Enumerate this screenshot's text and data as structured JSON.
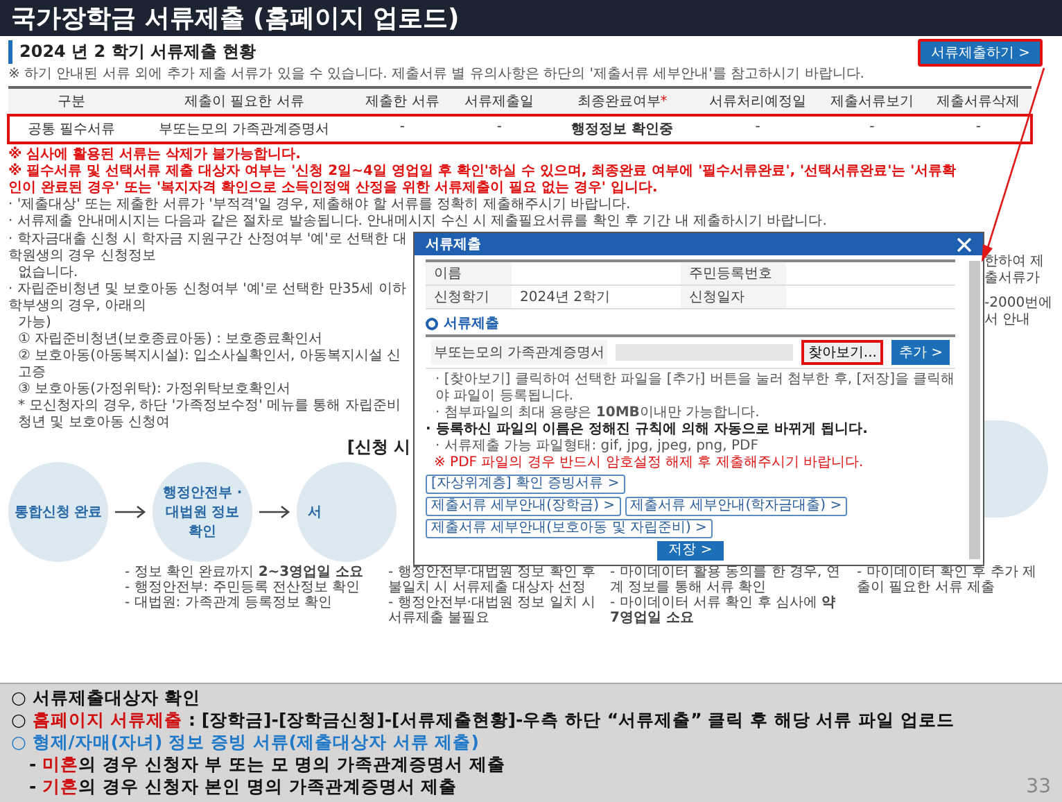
{
  "slide_title": "국가장학금 서류제출 (홈페이지 업로드)",
  "web": {
    "heading": "2024 년 2 학기 서류제출 현황",
    "submit_button": {
      "label": "서류제출하기 >",
      "highlighted": true
    },
    "notice": "※ 하기 안내된 서류 외에 추가 제출 서류가 있을 수 있습니다. 제출서류 별 유의사항은 하단의 '제출서류 세부안내'를 참고하시기 바랍니다.",
    "table": {
      "columns": [
        {
          "label": "구분"
        },
        {
          "label": "제출이 필요한 서류"
        },
        {
          "label": "제출한 서류"
        },
        {
          "label": "서류제출일"
        },
        {
          "label": "최종완료여부",
          "mark": "*"
        },
        {
          "label": "서류처리예정일"
        },
        {
          "label": "제출서류보기"
        },
        {
          "label": "제출서류삭제"
        }
      ],
      "rows": [
        {
          "highlighted": true,
          "cells": [
            {
              "text": "공통 필수서류",
              "bold": false
            },
            {
              "text": "부또는모의 가족관계증명서",
              "bold": false
            },
            {
              "text": "-",
              "bold": false
            },
            {
              "text": "-",
              "bold": false
            },
            {
              "text": "행정정보 확인중",
              "bold": true
            },
            {
              "text": "-",
              "bold": false
            },
            {
              "text": "-",
              "bold": false
            },
            {
              "text": "-",
              "bold": false
            }
          ]
        }
      ]
    },
    "warnings": [
      "※ 심사에 활용된 서류는 삭제가 불가능합니다.",
      "※ 필수서류 및 선택서류 제출 대상자 여부는 '신청 2일~4일 영업일 후 확인'하실 수 있으며, 최종완료 여부에 '필수서류완료', '선택서류완료'는 '서류확인이 완료된 경우' 또는 '복지자격 확인으로 소득인정액 산정을 위한 서류제출이 필요 없는 경우' 입니다."
    ],
    "bullets": [
      "· '제출대상' 또는 제출한 서류가 '부적격'일 경우, 제출해야 할 서류를 정확히 제출해주시기 바랍니다.",
      "· 서류제출 안내메시지는 다음과 같은 절차로 발송됩니다. 안내메시지 수신 시 제출필요서류를 확인 후 기간 내 제출하시기 바랍니다."
    ],
    "left_notes": [
      {
        "kind": "bullet",
        "text": "· 학자금대출 신청 시 학자금 지원구간 산정여부 '예'로 선택한 대학원생의 경우 신청정보"
      },
      {
        "kind": "plain",
        "text": "없습니다."
      },
      {
        "kind": "bullet",
        "text": "· 자립준비청년 및 보호아동 신청여부 '예'로 선택한 만35세 이하 학부생의 경우, 아래의"
      },
      {
        "kind": "plain",
        "text": "가능)"
      },
      {
        "kind": "sub",
        "text": "① 자립준비청년(보호종료아동) : 보호종료확인서"
      },
      {
        "kind": "sub",
        "text": "② 보호아동(아동복지시설): 입소사실확인서, 아동복지시설 신고증"
      },
      {
        "kind": "sub",
        "text": "③ 보호아동(가정위탁): 가정위탁보호확인서"
      },
      {
        "kind": "sub",
        "text": "* 모신청자의 경우, 하단 '가족정보수정' 메뉴를 통해 자립준비청년 및 보호아동 신청여"
      }
    ],
    "right_notes": [
      "한하여 제출서류가",
      "-2000번에서 안내"
    ],
    "flow": {
      "heading": "[신청 시",
      "steps": [
        {
          "label": "통합신청 완료"
        },
        {
          "label": "행정안전부 · 대법원 정보 확인"
        },
        {
          "label": "서"
        }
      ],
      "details": [
        [
          "- 정보 확인 완료까지 **2~3영업일 소요**",
          "- 행정안전부: 주민등록 전산정보 확인",
          "- 대법원: 가족관계 등록정보 확인"
        ],
        [
          "- 행정안전부·대법원 정보 확인 후 불일치 시 서류제출 대상자 선정",
          "- 행정안전부·대법원 정보 일치 시 서류제출 불필요"
        ],
        [
          "- 마이데이터 활용 동의를 한 경우, 연계 정보를 통해 서류 확인",
          "- 마이데이터 서류 확인 후 심사에 **약 7영업일 소요**"
        ],
        [
          "- 마이데이터 확인 후 추가 제출이 필요한 서류 제출"
        ]
      ]
    }
  },
  "modal": {
    "title": "서류제출",
    "info_rows": [
      [
        {
          "label": "이름"
        },
        {
          "label": "주민등록번호"
        }
      ],
      [
        {
          "label": "신청학기",
          "value": "2024년 2학기"
        },
        {
          "label": "신청일자"
        }
      ]
    ],
    "section": "서류제출",
    "upload": {
      "label": "부또는모의 가족관계증명서",
      "browse": {
        "label": "찾아보기...",
        "highlighted": true
      },
      "add": "추가 >"
    },
    "notes": [
      {
        "kind": "plain",
        "text": "· [찾아보기] 클릭하여 선택한 파일을 [추가] 버튼을 눌러 첨부한 후, [저장]을 클릭해야 파일이 등록됩니다."
      },
      {
        "kind": "plain",
        "text": "· 첨부파일의 최대 용량은 **10MB**이내만 가능합니다."
      },
      {
        "kind": "bold",
        "text": "· 등록하신 파일의 이름은 정해진 규칙에 의해 자동으로 바뀌게 됩니다."
      },
      {
        "kind": "plain",
        "text": "· 서류제출 가능 파일형태: gif, jpg, jpeg, png, PDF"
      },
      {
        "kind": "warning",
        "text": "※ PDF 파일의 경우 반드시 암호설정 해제 후 제출해주시기 바랍니다."
      }
    ],
    "links": [
      [
        "[자상위계층] 확인 증빙서류 >"
      ],
      [
        "제출서류 세부안내(장학금) >",
        "제출서류 세부안내(학자금대출) >",
        "제출서류 세부안내(보호아동 및 자립준비) >"
      ]
    ],
    "save": "저장 >"
  },
  "notes": [
    {
      "segments": [
        {
          "text": "○ 서류제출대상자 확인"
        }
      ]
    },
    {
      "color": "#d01010",
      "segments": [
        {
          "text": "○ ",
          "accent": false
        },
        {
          "text": "홈페이지 서류제출",
          "accent": true
        },
        {
          "text": " : [장학금]-[장학금신청]-[서류제출현황]-우측 하단 “서류제출” 클릭 후 해당 서류 파일 업로드",
          "accent": false
        }
      ]
    },
    {
      "color": "#1f78c8",
      "segments": [
        {
          "text": "○ 형제/자매(자녀) 정보 증빙 서류(제출대상자 서류 제출)",
          "accent": true
        }
      ]
    },
    {
      "color": "#d01010",
      "segments": [
        {
          "text": "   - ",
          "accent": false
        },
        {
          "text": "미혼",
          "accent": true
        },
        {
          "text": "의 경우 신청자 부 또는 모 명의 가족관계증명서 제출",
          "accent": false
        }
      ]
    },
    {
      "color": "#d01010",
      "segments": [
        {
          "text": "   - ",
          "accent": false
        },
        {
          "text": "기혼",
          "accent": true
        },
        {
          "text": "의 경우 신청자 본인 명의 가족관계증명서 제출",
          "accent": false
        }
      ]
    }
  ],
  "page_number": "33"
}
